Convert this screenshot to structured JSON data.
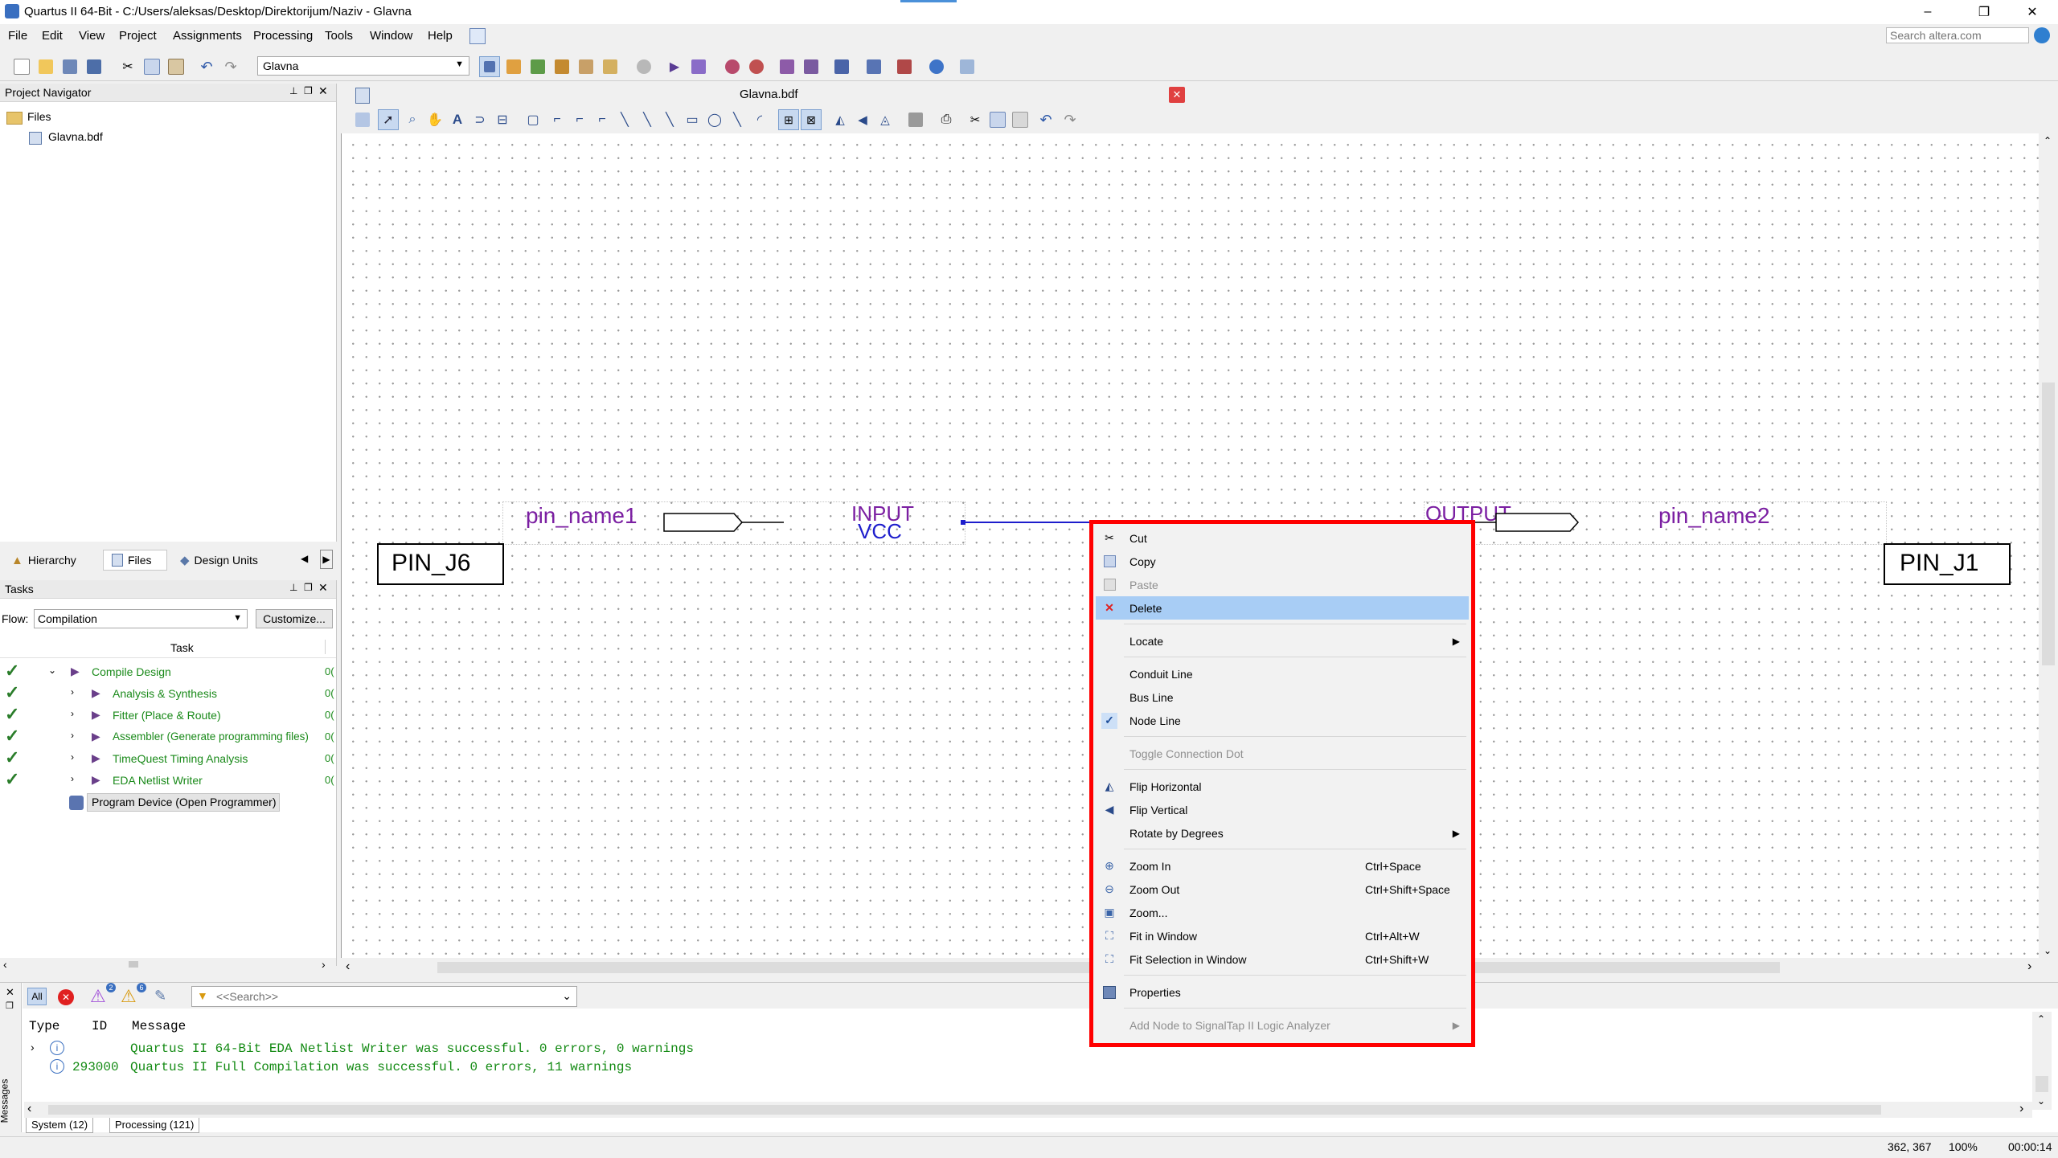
{
  "window": {
    "title": "Quartus II 64-Bit - C:/Users/aleksas/Desktop/Direktorijum/Naziv - Glavna",
    "controls": [
      "–",
      "❐",
      "✕"
    ]
  },
  "menubar": {
    "items": [
      "File",
      "Edit",
      "View",
      "Project",
      "Assignments",
      "Processing",
      "Tools",
      "Window",
      "Help"
    ],
    "search_placeholder": "Search altera.com"
  },
  "toolbar": {
    "project_select": "Glavna"
  },
  "project_navigator": {
    "title": "Project Navigator",
    "root": "Files",
    "files": [
      "Glavna.bdf"
    ],
    "tabs": [
      "Hierarchy",
      "Files",
      "Design Units"
    ]
  },
  "tasks": {
    "title": "Tasks",
    "flow_label": "Flow:",
    "flow_value": "Compilation",
    "customize_label": "Customize...",
    "column_header": "Task",
    "rows": [
      {
        "label": "Compile Design",
        "status": "done"
      },
      {
        "label": "Analysis & Synthesis",
        "status": "done"
      },
      {
        "label": "Fitter (Place & Route)",
        "status": "done"
      },
      {
        "label": "Assembler (Generate programming files)",
        "status": "done"
      },
      {
        "label": "TimeQuest Timing Analysis",
        "status": "done"
      },
      {
        "label": "EDA Netlist Writer",
        "status": "done"
      },
      {
        "label": "Program Device (Open Programmer)",
        "status": "none"
      }
    ],
    "time_prefix": "0("
  },
  "editor": {
    "tab_title": "Glavna.bdf",
    "input_pin": {
      "name": "pin_name1",
      "type": "INPUT",
      "default": "VCC",
      "location": "PIN_J6"
    },
    "output_pin": {
      "name": "pin_name2",
      "type": "OUTPUT",
      "location": "PIN_J1"
    }
  },
  "context_menu": {
    "items": [
      {
        "label": "Cut",
        "icon": "scissors-icon"
      },
      {
        "label": "Copy",
        "icon": "copy-icon"
      },
      {
        "label": "Paste",
        "icon": "paste-icon",
        "disabled": true
      },
      {
        "label": "Delete",
        "icon": "delete-icon",
        "highlighted": true
      },
      {
        "label": "Locate",
        "submenu": true
      },
      {
        "label": "Conduit Line"
      },
      {
        "label": "Bus Line"
      },
      {
        "label": "Node Line",
        "checked": true
      },
      {
        "label": "Toggle Connection Dot",
        "disabled": true
      },
      {
        "label": "Flip Horizontal",
        "icon": "flip-horizontal-icon"
      },
      {
        "label": "Flip Vertical",
        "icon": "flip-vertical-icon"
      },
      {
        "label": "Rotate by Degrees",
        "submenu": true
      },
      {
        "label": "Zoom In",
        "icon": "zoom-in-icon",
        "shortcut": "Ctrl+Space"
      },
      {
        "label": "Zoom Out",
        "icon": "zoom-out-icon",
        "shortcut": "Ctrl+Shift+Space"
      },
      {
        "label": "Zoom...",
        "icon": "zoom-icon"
      },
      {
        "label": "Fit in Window",
        "icon": "fit-window-icon",
        "shortcut": "Ctrl+Alt+W"
      },
      {
        "label": "Fit Selection in Window",
        "icon": "fit-selection-icon",
        "shortcut": "Ctrl+Shift+W"
      },
      {
        "label": "Properties",
        "icon": "properties-icon"
      },
      {
        "label": "Add Node to SignalTap II Logic Analyzer",
        "disabled": true,
        "submenu": true
      }
    ]
  },
  "messages": {
    "filter_all": "All",
    "badge_critical": "2",
    "badge_warning": "6",
    "search_placeholder": "<<Search>>",
    "columns": [
      "Type",
      "ID",
      "Message"
    ],
    "rows": [
      {
        "id": "",
        "text": "Quartus II 64-Bit EDA Netlist Writer was successful. 0 errors, 0 warnings"
      },
      {
        "id": "293000",
        "text": "Quartus II Full Compilation was successful. 0 errors, 11 warnings"
      }
    ],
    "tabs": [
      "System (12)",
      "Processing (121)"
    ],
    "side_label": "Messages"
  },
  "statusbar": {
    "coords": "362, 367",
    "zoom": "100%",
    "time": "00:00:14"
  },
  "colors": {
    "accent_red": "#ff0000",
    "highlight": "#a8cdf5",
    "pin_text": "#7b1fa2",
    "wire": "#1d1dcc",
    "task_green": "#1a8a1a"
  }
}
